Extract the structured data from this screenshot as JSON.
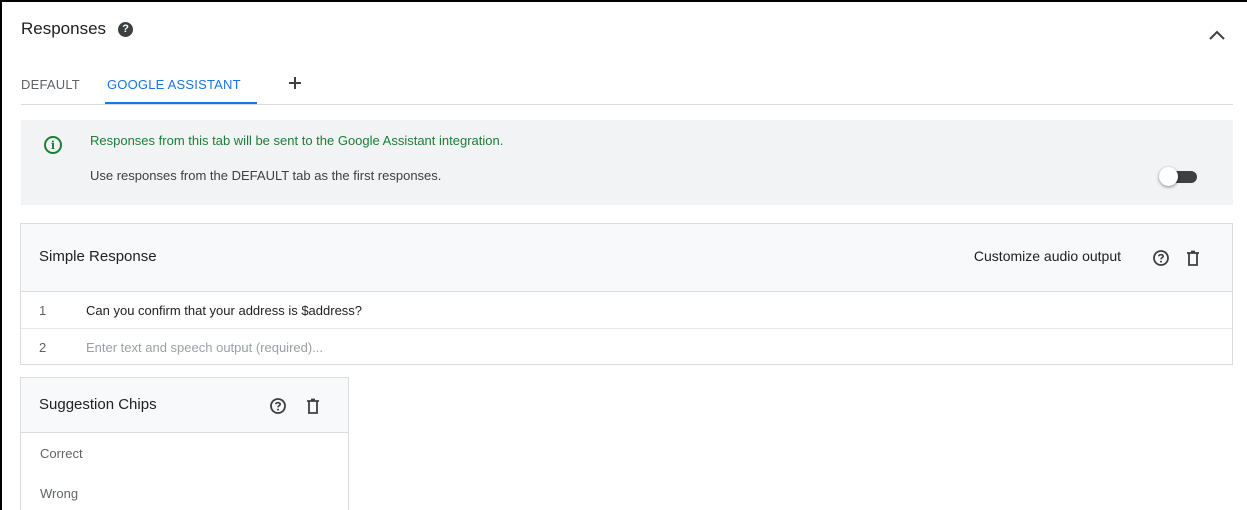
{
  "header": {
    "title": "Responses",
    "help_icon": "help-circle-icon",
    "collapse_icon": "chevron-up-icon"
  },
  "tabs": [
    {
      "label": "DEFAULT",
      "active": false
    },
    {
      "label": "GOOGLE ASSISTANT",
      "active": true
    }
  ],
  "add_tab_icon": "plus-icon",
  "info_banner": {
    "icon": "info-icon",
    "message": "Responses from this tab will be sent to the Google Assistant integration.",
    "toggle_label": "Use responses from the DEFAULT tab as the first responses.",
    "toggle_on": false
  },
  "simple_response": {
    "title": "Simple Response",
    "customize_label": "Customize audio output",
    "rows": [
      {
        "num": "1",
        "text": "Can you confirm that your address is $address?"
      },
      {
        "num": "2",
        "placeholder": "Enter text and speech output (required)..."
      }
    ]
  },
  "suggestion_chips": {
    "title": "Suggestion Chips",
    "chips": [
      "Correct",
      "Wrong"
    ]
  },
  "colors": {
    "accent": "#1a73e8",
    "info_green": "#188038",
    "banner_bg": "#f1f3f4"
  }
}
